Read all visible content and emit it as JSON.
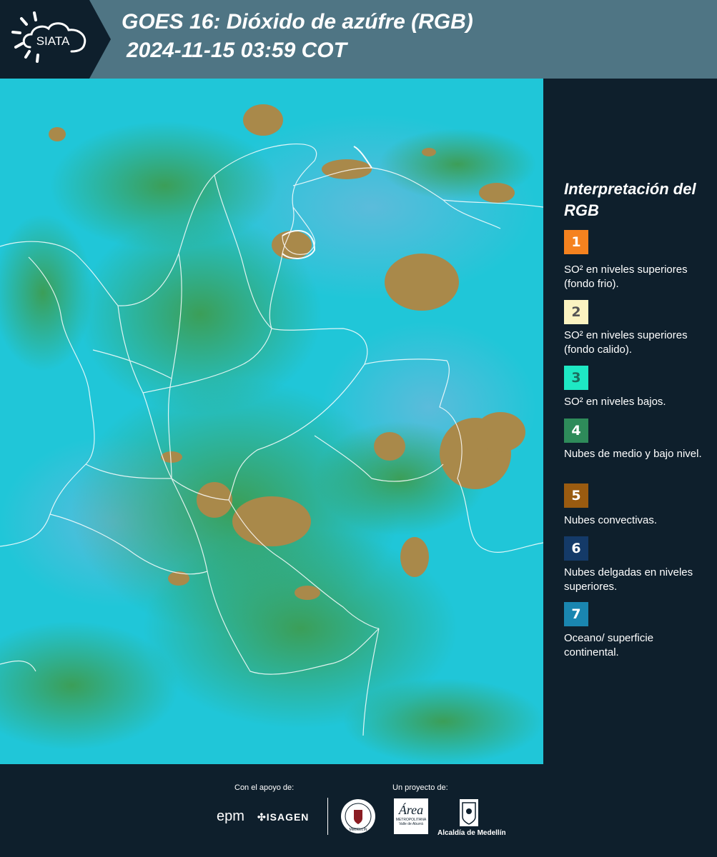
{
  "header": {
    "logo_text": "SIATA",
    "title_line1": "GOES 16: Dióxido de azúfre (RGB)",
    "title_line2": "2024-11-15 03:59 COT",
    "background_color": "#4f7584"
  },
  "legend": {
    "title": "Interpretación del RGB",
    "items": [
      {
        "number": "1",
        "label": "SO² en niveles superiores (fondo frio).",
        "color": "#f5821f",
        "text_color": "#ffffff"
      },
      {
        "number": "2",
        "label": "SO² en niveles superiores (fondo calido).",
        "color": "#fbf3c1",
        "text_color": "#555555"
      },
      {
        "number": "3",
        "label": "SO² en niveles bajos.",
        "color": "#1ee8c4",
        "text_color": "#1a6e60"
      },
      {
        "number": "4",
        "label": "Nubes de medio y bajo nivel.",
        "color": "#2e8b5a",
        "text_color": "#ffffff"
      },
      {
        "number": "5",
        "label": "Nubes convectivas.",
        "color": "#9a5b10",
        "text_color": "#ffffff"
      },
      {
        "number": "6",
        "label": "Nubes delgadas en niveles superiores.",
        "color": "#143a68",
        "text_color": "#ffffff"
      },
      {
        "number": "7",
        "label": "Oceano/ superficie continental.",
        "color": "#1a86b0",
        "text_color": "#ffffff"
      }
    ]
  },
  "footer": {
    "support_label": "Con el apoyo de:",
    "project_label": "Un proyecto de:",
    "sponsor1": "epm",
    "sponsor2": "ISAGEN",
    "partner_area_1": "Área",
    "partner_area_2": "METROPOLITANA",
    "partner_area_3": "Valle de Aburrá",
    "partner_alcaldia": "Alcaldía de Medellín",
    "partner_seal": "MEDELLÍN"
  }
}
